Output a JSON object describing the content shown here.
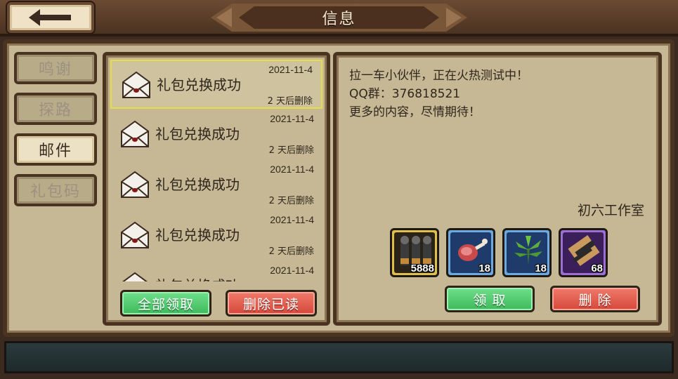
{
  "header": {
    "title": "信息",
    "back_icon": "arrow-left-icon"
  },
  "tabs": [
    {
      "label": "鸣谢",
      "active": false
    },
    {
      "label": "探路",
      "active": false
    },
    {
      "label": "邮件",
      "active": true
    },
    {
      "label": "礼包码",
      "active": false
    }
  ],
  "mail_list": {
    "items": [
      {
        "title": "礼包兑换成功",
        "date": "2021-11-4",
        "expire": "2 天后删除",
        "selected": true
      },
      {
        "title": "礼包兑换成功",
        "date": "2021-11-4",
        "expire": "2 天后删除",
        "selected": false
      },
      {
        "title": "礼包兑换成功",
        "date": "2021-11-4",
        "expire": "2 天后删除",
        "selected": false
      },
      {
        "title": "礼包兑换成功",
        "date": "2021-11-4",
        "expire": "2 天后删除",
        "selected": false
      },
      {
        "title": "礼包兑换成功",
        "date": "2021-11-4",
        "expire": "",
        "selected": false
      }
    ],
    "claim_all_label": "全部领取",
    "delete_read_label": "删除已读"
  },
  "detail": {
    "lines": [
      "拉一车小伙伴，正在火热测试中！",
      "QQ群：376818521",
      "更多的内容，尽情期待！"
    ],
    "signature": "初六工作室",
    "rewards": [
      {
        "icon": "bullets-icon",
        "count": "5888",
        "bg": "#2a2418",
        "border": "#e0c04a"
      },
      {
        "icon": "meat-icon",
        "count": "18",
        "bg": "#1f3b6b",
        "border": "#6fa8dc"
      },
      {
        "icon": "herb-icon",
        "count": "18",
        "bg": "#1f3b6b",
        "border": "#6fa8dc"
      },
      {
        "icon": "scroll-icon",
        "count": "68",
        "bg": "#3a1f5a",
        "border": "#9d6fd0"
      }
    ],
    "claim_label": "领  取",
    "delete_label": "删  除"
  }
}
